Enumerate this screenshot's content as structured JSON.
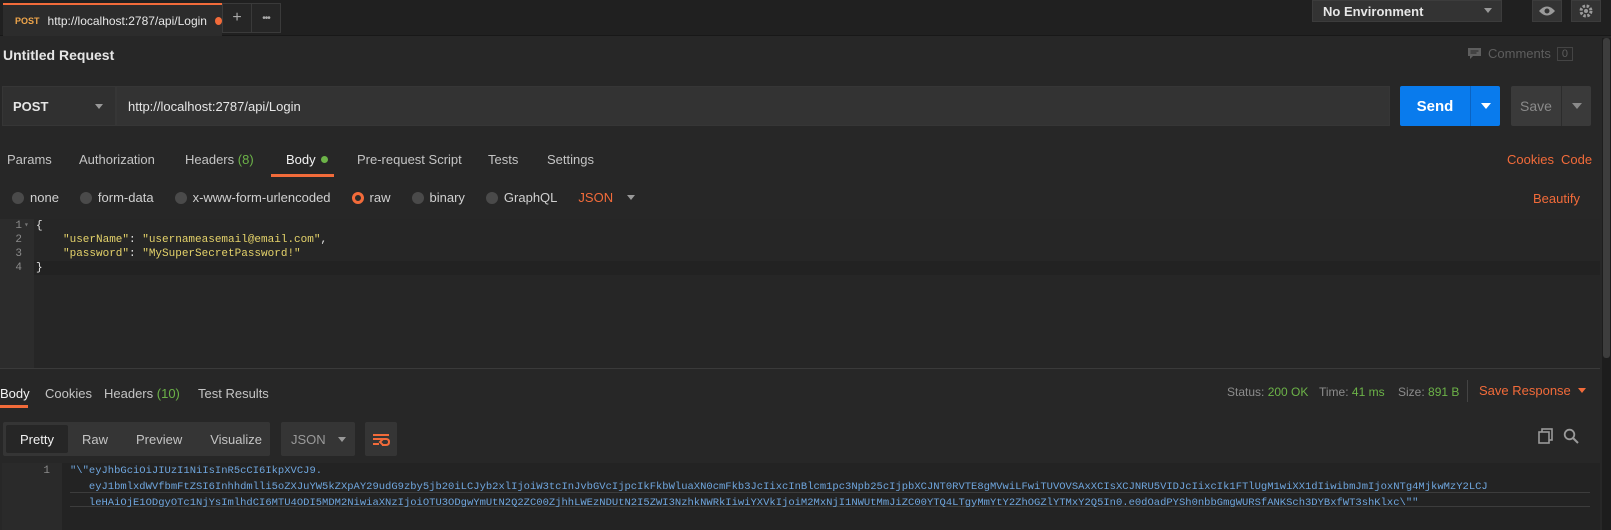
{
  "tab": {
    "method": "POST",
    "url": "http://localhost:2787/api/Login",
    "add_label": "+",
    "more_label": "•••"
  },
  "environment": {
    "selected": "No Environment"
  },
  "request": {
    "title": "Untitled Request",
    "comments_label": "Comments",
    "comments_count": "0",
    "method": "POST",
    "url": "http://localhost:2787/api/Login",
    "send_label": "Send",
    "save_label": "Save"
  },
  "request_tabs": {
    "params": "Params",
    "authorization": "Authorization",
    "headers": "Headers",
    "headers_count": "(8)",
    "body": "Body",
    "prerequest": "Pre-request Script",
    "tests": "Tests",
    "settings": "Settings",
    "cookies": "Cookies",
    "code": "Code"
  },
  "body_types": {
    "none": "none",
    "form_data": "form-data",
    "urlencoded": "x-www-form-urlencoded",
    "raw": "raw",
    "binary": "binary",
    "graphql": "GraphQL",
    "format": "JSON",
    "beautify": "Beautify",
    "selected": "raw"
  },
  "editor": {
    "line_numbers": [
      "1",
      "2",
      "3",
      "4"
    ],
    "open_brace": "{",
    "close_brace": "}",
    "username_key": "\"userName\"",
    "username_value": "\"usernameasemail@email.com\"",
    "password_key": "\"password\"",
    "password_value": "\"MySuperSecretPassword!\""
  },
  "response_tabs": {
    "body": "Body",
    "cookies": "Cookies",
    "headers": "Headers",
    "headers_count": "(10)",
    "test_results": "Test Results"
  },
  "response_status": {
    "status_label": "Status:",
    "status_value": "200 OK",
    "time_label": "Time:",
    "time_value": "41 ms",
    "size_label": "Size:",
    "size_value": "891 B",
    "save_response": "Save Response"
  },
  "response_view": {
    "pretty": "Pretty",
    "raw": "Raw",
    "preview": "Preview",
    "visualize": "Visualize",
    "format": "JSON"
  },
  "response_body": {
    "line_number": "1",
    "lines": [
      "\"\\\"eyJhbGciOiJIUzI1NiIsInR5cCI6IkpXVCJ9.",
      "   eyJ1bmlxdWVfbmFtZSI6Inhhdmlli5oZXJuYW5kZXpAY29udG9zby5jb20iLCJyb2xlIjoiW3tcInJvbGVcIjpcIkFkbWluaXN0cmFkb3JcIixcInBlcm1pc3Npb25cIjpbXCJNT0RVTE8gMVwiLFwiTUVOVSAxXCIsXCJNRU5VIDJcIixcIk1FTlUgM1wiXX1dIiwibmJmIjoxNTg4MjkwMzY2LCJ",
      "   leHAiOjE1ODgyOTc1NjYsImlhdCI6MTU4ODI5MDM2NiwiaXNzIjoiOTU3ODgwYmUtN2Q2ZC00ZjhhLWEzNDUtN2I5ZWI3NzhkNWRkIiwiYXVkIjoiM2MxNjI1NWUtMmJiZC00YTQ4LTgyMmYtY2ZhOGZlYTMxY2Q5In0.e0dOadPYSh0nbbGmgWURSfANKSch3DYBxfWT3shKlxc\\\"\""
    ]
  }
}
